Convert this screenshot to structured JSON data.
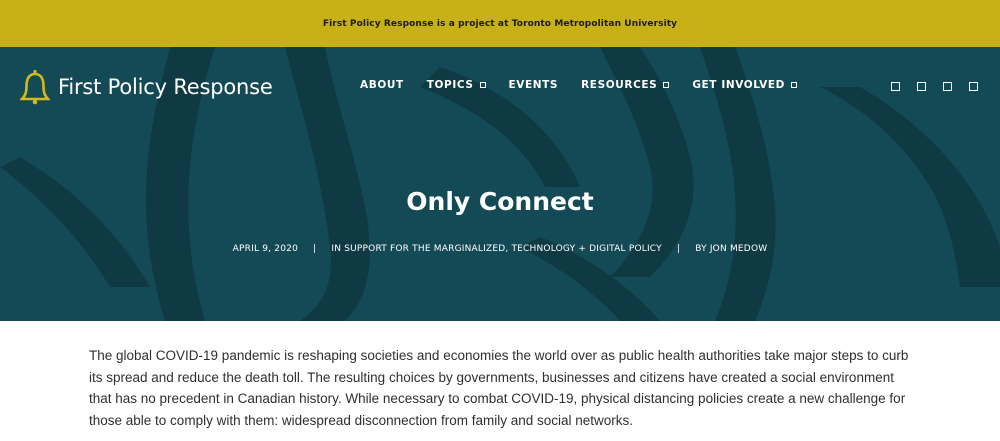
{
  "topbar": {
    "text": "First Policy Response is a project at Toronto Metropolitan University"
  },
  "header": {
    "site_title": "First Policy Response",
    "logo_icon": "bell-icon",
    "nav": [
      {
        "label": "ABOUT",
        "has_dropdown": false
      },
      {
        "label": "TOPICS",
        "has_dropdown": true
      },
      {
        "label": "EVENTS",
        "has_dropdown": false
      },
      {
        "label": "RESOURCES",
        "has_dropdown": true
      },
      {
        "label": "GET INVOLVED",
        "has_dropdown": true
      }
    ],
    "social_icons": [
      "social-icon-1",
      "social-icon-2",
      "social-icon-3",
      "social-icon-4"
    ]
  },
  "article": {
    "title": "Only Connect",
    "date": "APRIL 9, 2020",
    "categories": "IN SUPPORT FOR THE MARGINALIZED, TECHNOLOGY + DIGITAL POLICY",
    "author": "BY JON MEDOW",
    "separator": "|",
    "body": "The global COVID-19 pandemic is reshaping societies and economies the world over as public health authorities take major steps to curb its spread and reduce the death toll. The resulting choices by governments, businesses and citizens have created a social environment that has no precedent in Canadian history. While necessary to combat COVID-19, physical distancing  policies create a new challenge for those able to comply with them: widespread disconnection from family and social networks."
  },
  "colors": {
    "topbar_bg": "#c7b116",
    "hero_bg": "#144a55",
    "hero_shapes": "#0f3a44",
    "accent": "#d4bb1c",
    "body_text": "#2f2f2f"
  }
}
